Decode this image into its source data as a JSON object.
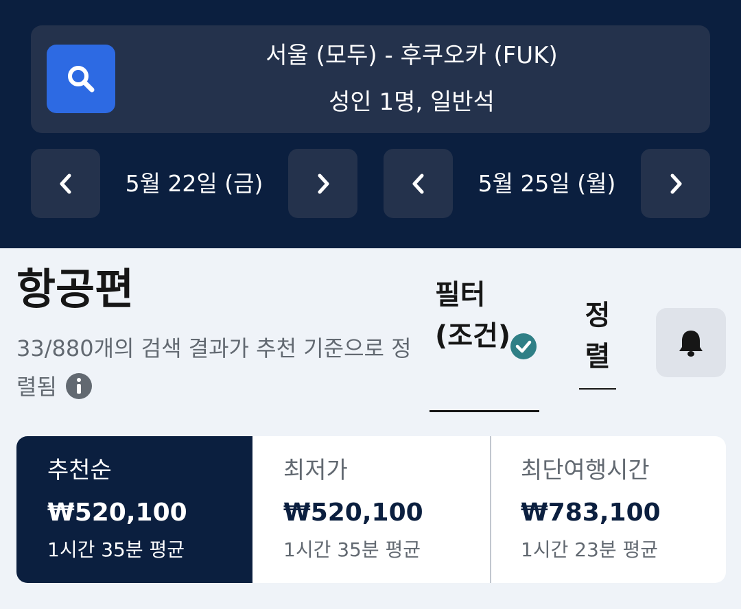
{
  "search": {
    "route": "서울 (모두) - 후쿠오카 (FUK)",
    "passengers": "성인 1명, 일반석"
  },
  "dates": {
    "depart": "5월 22일 (금)",
    "return": "5월 25일 (월)"
  },
  "results": {
    "title": "항공편",
    "description": "33/880개의 검색 결과가 추천 기준으로 정렬됨",
    "filter_label": "필터(조건)",
    "sort_label": "정렬"
  },
  "sort_options": [
    {
      "label": "추천순",
      "price": "₩520,100",
      "duration": "1시간 35분 평균",
      "selected": true
    },
    {
      "label": "최저가",
      "price": "₩520,100",
      "duration": "1시간 35분 평균",
      "selected": false
    },
    {
      "label": "최단여행시간",
      "price": "₩783,100",
      "duration": "1시간 23분 평균",
      "selected": false
    }
  ],
  "icons": {
    "search": "search-icon",
    "prev": "chevron-left-icon",
    "next": "chevron-right-icon",
    "info": "info-icon",
    "check": "check-circle-icon",
    "alert": "bell-icon"
  },
  "colors": {
    "header_bg": "#0b1f3f",
    "panel_bg": "#24324c",
    "accent": "#2d6ae3",
    "check": "#2f7f86"
  }
}
